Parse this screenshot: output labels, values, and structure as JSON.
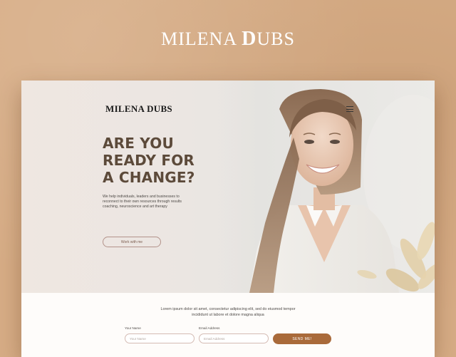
{
  "brand": {
    "part1": "MILENA ",
    "part2": "D",
    "part3": "UBS"
  },
  "site": {
    "logo": "MILENA DUBS",
    "hero": {
      "headline": [
        "ARE YOU",
        "READY FOR",
        "A CHANGE?"
      ],
      "intro": "We help individuals, leaders and businesses to reconnect to their own resources through results coaching, neuroscience and art therapy",
      "cta_label": "Work with me"
    },
    "form": {
      "description": "Lorem ipsum dolor sit amet, consectetur adipiscing elit, sed do eiusmod tempor incididunt ut labore et dolore magna aliqua",
      "name_label": "Your Name",
      "name_placeholder": "Your Name",
      "email_label": "Email Address",
      "email_placeholder": "Email Address",
      "submit_label": "SEND ME!"
    }
  },
  "colors": {
    "page_background": "#d7ad86",
    "headline": "#5c4a3a",
    "submit_button": "#a96a3a",
    "cta_border": "#b3928a"
  }
}
